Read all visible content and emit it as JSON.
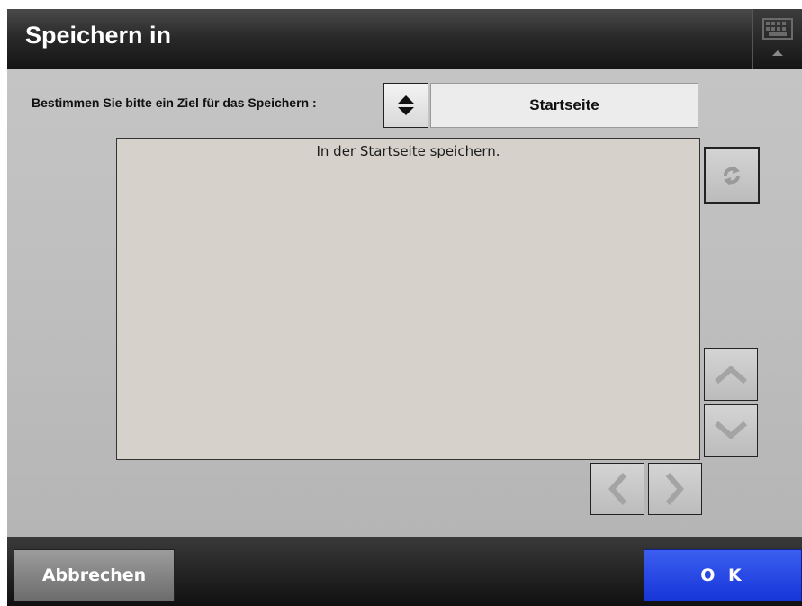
{
  "title": "Speichern in",
  "header": {
    "keyboard_icon": "keyboard-icon"
  },
  "destination": {
    "label": "Bestimmen Sie bitte ein Ziel für das Speichern :",
    "value": "Startseite",
    "spinner_icon": "up-down-arrows-icon"
  },
  "content": {
    "message": "In der Startseite speichern."
  },
  "controls": {
    "refresh_icon": "refresh-icon",
    "scroll_up_icon": "chevron-up-icon",
    "scroll_down_icon": "chevron-down-icon",
    "page_left_icon": "chevron-left-icon",
    "page_right_icon": "chevron-right-icon"
  },
  "footer": {
    "cancel_label": "Abbrechen",
    "ok_label": "O K"
  },
  "colors": {
    "ok_button": "#1e3fe0",
    "cancel_button": "#848484",
    "content_area": "#d6d2cb",
    "panel_bg": "#bdbdbd"
  }
}
